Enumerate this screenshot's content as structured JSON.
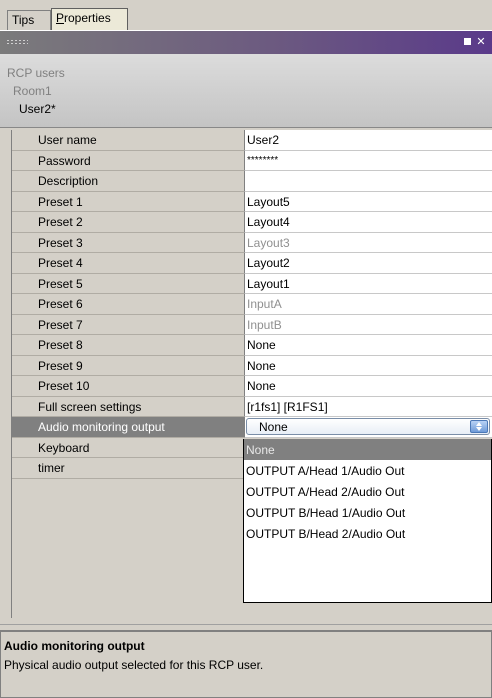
{
  "tabs": [
    {
      "label": "Tips"
    },
    {
      "label": "Properties",
      "underline": "P",
      "rest": "roperties"
    }
  ],
  "header": {
    "crumbs": [
      "RCP users",
      "Room1",
      "User2*"
    ]
  },
  "properties": [
    {
      "label": "User name",
      "value": "User2"
    },
    {
      "label": "Password",
      "value": "********"
    },
    {
      "label": "Description",
      "value": ""
    },
    {
      "label": "Preset 1",
      "value": "Layout5"
    },
    {
      "label": "Preset 2",
      "value": "Layout4"
    },
    {
      "label": "Preset 3",
      "value": "Layout3"
    },
    {
      "label": "Preset 4",
      "value": "Layout2"
    },
    {
      "label": "Preset 5",
      "value": "Layout1"
    },
    {
      "label": "Preset 6",
      "value": "InputA"
    },
    {
      "label": "Preset 7",
      "value": "InputB"
    },
    {
      "label": "Preset 8",
      "value": "None"
    },
    {
      "label": "Preset 9",
      "value": "None"
    },
    {
      "label": "Preset 10",
      "value": "None"
    },
    {
      "label": "Full screen settings",
      "value": "[r1fs1] [R1FS1]"
    },
    {
      "label": "Audio monitoring output",
      "value": "None"
    },
    {
      "label": "Keyboard",
      "value": ""
    },
    {
      "label": "timer",
      "value": ""
    }
  ],
  "dropdown": {
    "options": [
      "None",
      "OUTPUT A/Head 1/Audio Out",
      "OUTPUT A/Head 2/Audio Out",
      "OUTPUT B/Head 1/Audio Out",
      "OUTPUT B/Head 2/Audio Out"
    ]
  },
  "description": {
    "title": "Audio monitoring output",
    "text": "Physical audio output selected for this RCP user."
  },
  "colors": {
    "title_bar_end": "#5a3a8a",
    "selected_row": "#808080",
    "dim_text": "#909090"
  }
}
